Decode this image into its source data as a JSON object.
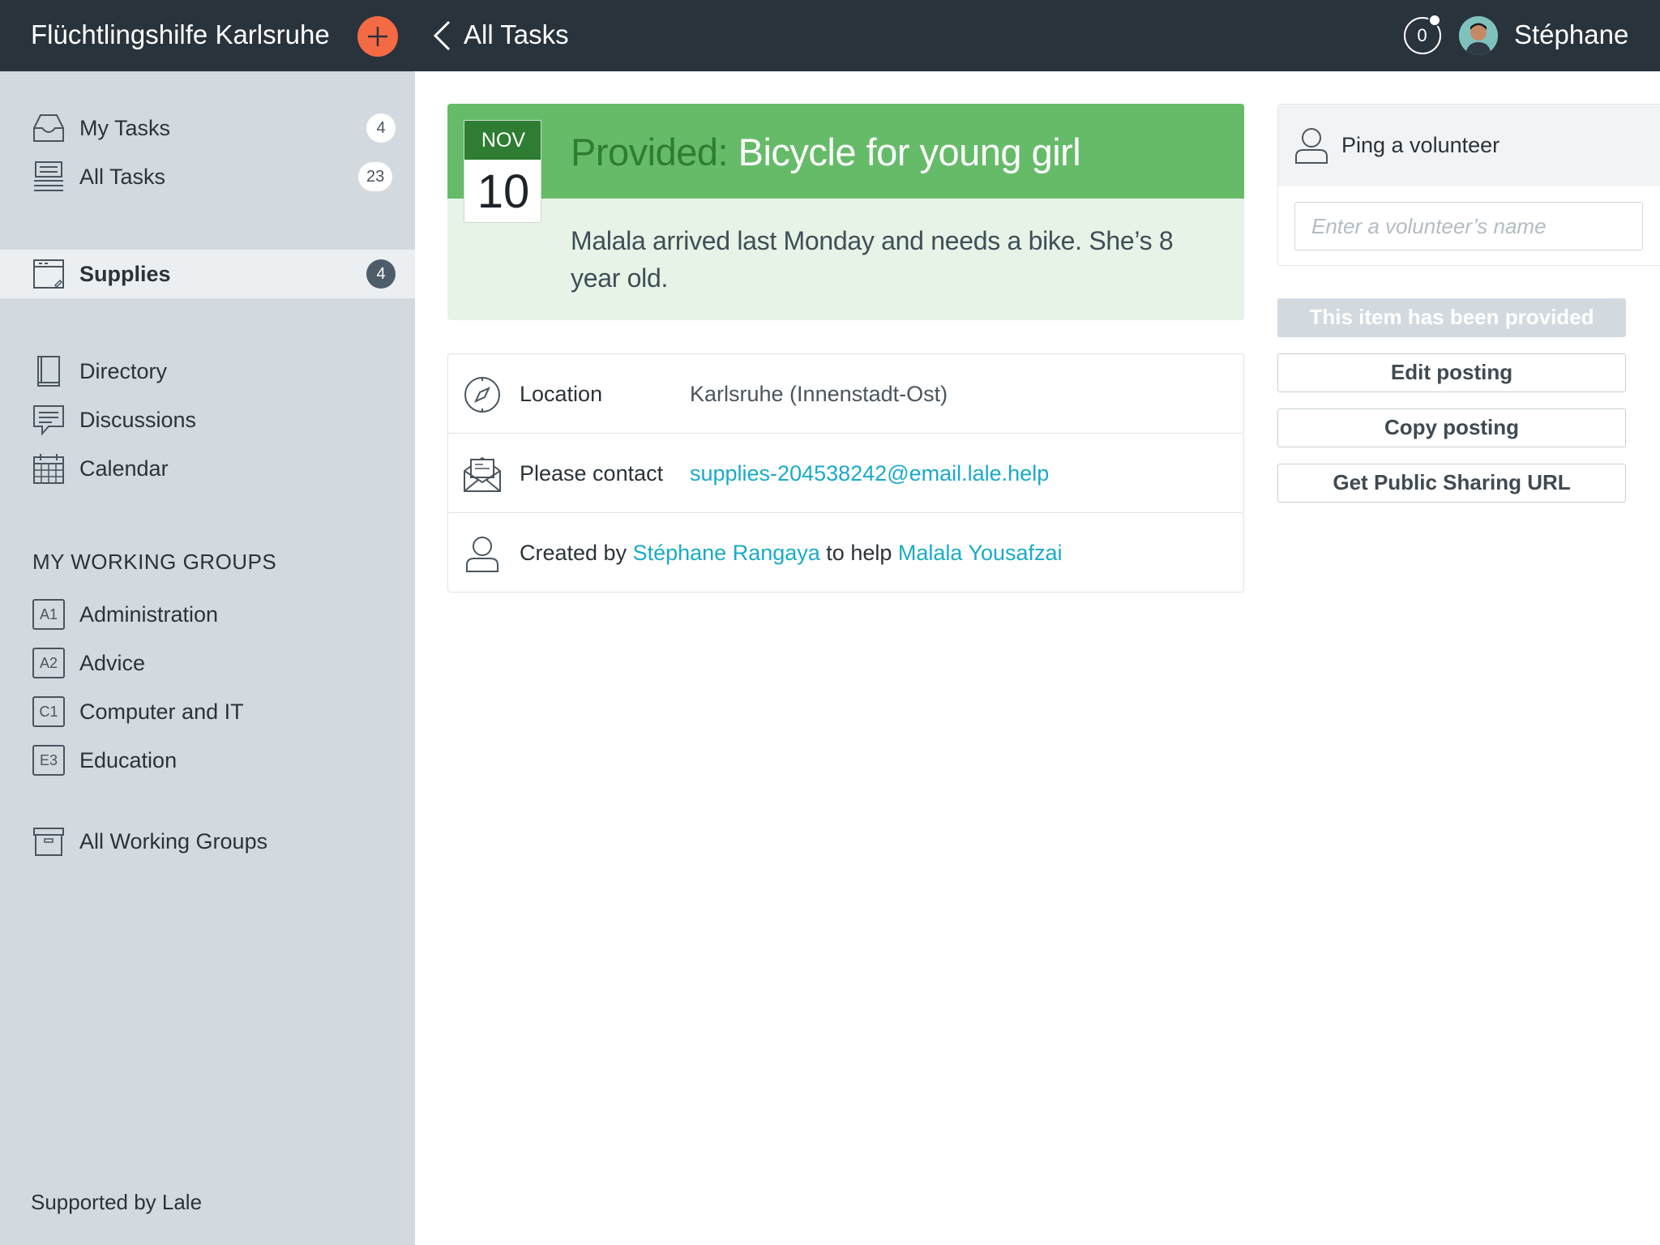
{
  "header": {
    "org_name": "Flüchtlingshilfe Karlsruhe",
    "back_label": "All Tasks",
    "notification_count": "0",
    "user_name": "Stéphane"
  },
  "sidebar": {
    "top_items": [
      {
        "label": "My Tasks",
        "badge": "4",
        "icon": "inbox-icon"
      },
      {
        "label": "All Tasks",
        "badge": "23",
        "icon": "stack-icon"
      }
    ],
    "active_item": {
      "label": "Supplies",
      "badge": "4",
      "icon": "supplies-icon"
    },
    "nav_items": [
      {
        "label": "Directory",
        "icon": "book-icon"
      },
      {
        "label": "Discussions",
        "icon": "chat-icon"
      },
      {
        "label": "Calendar",
        "icon": "calendar-icon"
      }
    ],
    "groups_header": "MY WORKING GROUPS",
    "groups": [
      {
        "code": "A1",
        "label": "Administration"
      },
      {
        "code": "A2",
        "label": "Advice"
      },
      {
        "code": "C1",
        "label": "Computer and IT"
      },
      {
        "code": "E3",
        "label": "Education"
      }
    ],
    "all_groups_label": "All Working Groups",
    "footer": "Supported by Lale"
  },
  "task": {
    "month": "NOV",
    "day": "10",
    "status_prefix": "Provided:",
    "title": "Bicycle for young girl",
    "description": "Malala arrived last Monday and needs a bike. She’s 8 year old."
  },
  "details": {
    "location_label": "Location",
    "location_value": "Karlsruhe (Innenstadt-Ost)",
    "contact_label": "Please contact",
    "contact_email": "supplies-204538242@email.lale.help",
    "created_prefix": "Created by",
    "creator": "Stéphane Rangaya",
    "help_text": "to help",
    "beneficiary": "Malala Yousafzai"
  },
  "actions": {
    "ping_label": "Ping a volunteer",
    "ping_placeholder": "Enter a volunteer’s name",
    "provided_label": "This item has been provided",
    "edit_label": "Edit posting",
    "copy_label": "Copy posting",
    "share_label": "Get Public Sharing URL"
  },
  "colors": {
    "topbar": "#29333c",
    "accent_orange": "#f46a45",
    "sidebar": "#d2dae0",
    "card_green": "#66bb69",
    "card_green_light": "#e6f3e6",
    "status_dark_green": "#2e7d32",
    "link": "#1aabc8"
  }
}
